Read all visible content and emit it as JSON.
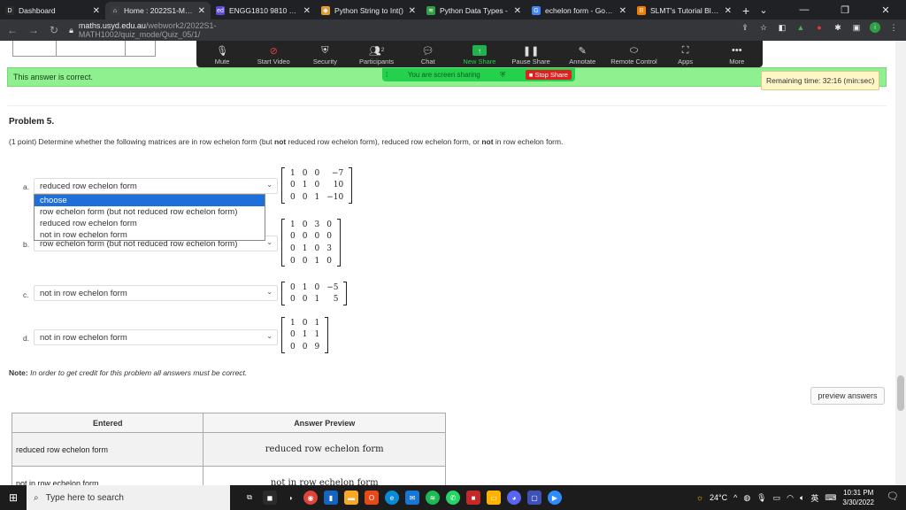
{
  "browser": {
    "tabs": [
      {
        "title": "Dashboard",
        "favicon_color": "#2b2b2b",
        "glyph": "D"
      },
      {
        "title": "Home : 2022S1-MATH",
        "favicon_color": "#3a3a3a",
        "glyph": "⌂"
      },
      {
        "title": "ENGG1810 9810 – We",
        "favicon_color": "#5b4bd6",
        "glyph": "ed"
      },
      {
        "title": "Python String to Int()",
        "favicon_color": "#e59c2c",
        "glyph": "◆"
      },
      {
        "title": "Python Data Types -",
        "favicon_color": "#2f9e44",
        "glyph": "≋"
      },
      {
        "title": "echelon form - Googl",
        "favicon_color": "#4285f4",
        "glyph": "G"
      },
      {
        "title": "SLMT's Tutorial Blog:",
        "favicon_color": "#f57c00",
        "glyph": "B"
      }
    ],
    "active_tab_index": 1,
    "url_host": "maths.usyd.edu.au",
    "url_path": "/webwork2/2022S1-MATH1002/quiz_mode/Quiz_05/1/"
  },
  "zoom": {
    "items": [
      "Mute",
      "Start Video",
      "Security",
      "Participants",
      "Chat",
      "New Share",
      "Pause Share",
      "Annotate",
      "Remote Control",
      "Apps",
      "More"
    ],
    "participants_count": "2",
    "sharing_label": "You are screen sharing",
    "stop_share_label": "Stop Share"
  },
  "page": {
    "correct_message": "This answer is correct.",
    "remaining_time": "Remaining time: 32:16 (min:sec)",
    "problem_title": "Problem 5.",
    "problem_points": "(1 point)",
    "problem_text_1": " Determine whether the following matrices are in row echelon form (but ",
    "problem_bold_1": "not",
    "problem_text_2": " reduced row echelon form), reduced row echelon form, or ",
    "problem_bold_2": "not",
    "problem_text_3": " in row echelon form.",
    "questions": [
      {
        "label": "a.",
        "selected": "reduced row echelon form"
      },
      {
        "label": "b.",
        "selected": "row echelon form (but not reduced row echelon form)"
      },
      {
        "label": "c.",
        "selected": "not in row echelon form"
      },
      {
        "label": "d.",
        "selected": "not in row echelon form"
      }
    ],
    "dropdown_options": [
      "choose",
      "row echelon form (but not reduced row echelon form)",
      "reduced row echelon form",
      "not in row echelon form"
    ],
    "dropdown_highlighted": "choose",
    "matrices": [
      [
        [
          "1",
          "0",
          "0",
          "−7"
        ],
        [
          "0",
          "1",
          "0",
          "10"
        ],
        [
          "0",
          "0",
          "1",
          "−10"
        ]
      ],
      [
        [
          "1",
          "0",
          "3",
          "0"
        ],
        [
          "0",
          "0",
          "0",
          "0"
        ],
        [
          "0",
          "1",
          "0",
          "3"
        ],
        [
          "0",
          "0",
          "1",
          "0"
        ]
      ],
      [
        [
          "0",
          "1",
          "0",
          "−5"
        ],
        [
          "0",
          "0",
          "1",
          "5"
        ]
      ],
      [
        [
          "1",
          "0",
          "1"
        ],
        [
          "0",
          "1",
          "1"
        ],
        [
          "0",
          "0",
          "9"
        ]
      ]
    ],
    "note_label": "Note:",
    "note_text": " In order to get credit for this problem all answers must be correct.",
    "preview_button": "preview answers",
    "results_headers": [
      "Entered",
      "Answer Preview"
    ],
    "results_rows": [
      [
        "reduced row echelon form",
        "reduced row echelon form"
      ],
      [
        "not in row echelon form",
        "not in row echelon form"
      ]
    ]
  },
  "taskbar": {
    "search_placeholder": "Type here to search",
    "temperature": "24°C",
    "time": "10:31 PM",
    "date": "3/30/2022",
    "ime": "英"
  }
}
